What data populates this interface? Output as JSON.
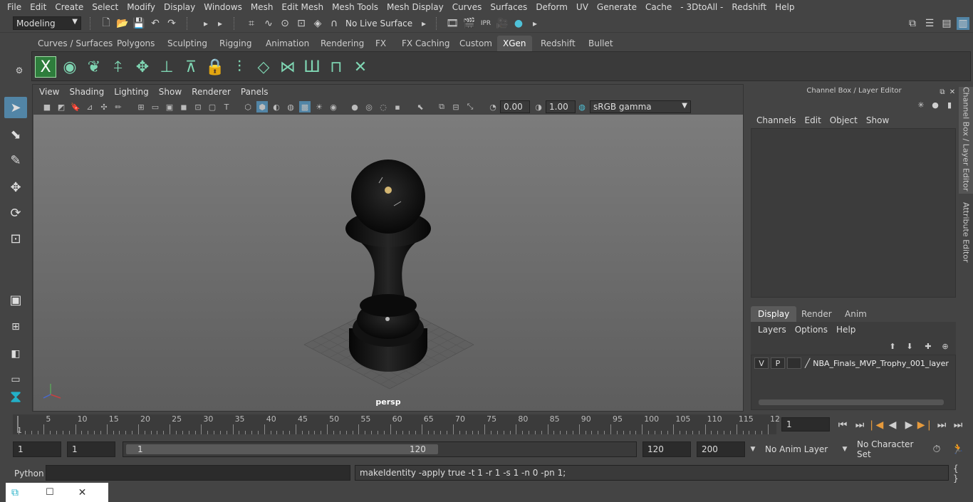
{
  "menu": [
    "File",
    "Edit",
    "Create",
    "Select",
    "Modify",
    "Display",
    "Windows",
    "Mesh",
    "Edit Mesh",
    "Mesh Tools",
    "Mesh Display",
    "Curves",
    "Surfaces",
    "Deform",
    "UV",
    "Generate",
    "Cache",
    "- 3DtoAll -",
    "Redshift",
    "Help"
  ],
  "status": {
    "mode": "Modeling",
    "live_surface": "No Live Surface"
  },
  "shelf_tabs": [
    "Curves / Surfaces",
    "Polygons",
    "Sculpting",
    "Rigging",
    "Animation",
    "Rendering",
    "FX",
    "FX Caching",
    "Custom",
    "XGen",
    "Redshift",
    "Bullet"
  ],
  "active_shelf": "XGen",
  "viewport": {
    "menu": [
      "View",
      "Shading",
      "Lighting",
      "Show",
      "Renderer",
      "Panels"
    ],
    "exposure": "0.00",
    "gamma": "1.00",
    "color_space": "sRGB gamma",
    "camera_label": "persp"
  },
  "channel_box": {
    "title": "Channel Box / Layer Editor",
    "menu": [
      "Channels",
      "Edit",
      "Object",
      "Show"
    ]
  },
  "layer_editor": {
    "tabs": [
      "Display",
      "Render",
      "Anim"
    ],
    "active_tab": "Display",
    "menu": [
      "Layers",
      "Options",
      "Help"
    ],
    "layer": {
      "v": "V",
      "p": "P",
      "name": "NBA_Finals_MVP_Trophy_001_layer"
    }
  },
  "side_tabs": [
    "Channel Box / Layer Editor",
    "Attribute Editor"
  ],
  "timeline": {
    "ticks": [
      "5",
      "10",
      "15",
      "20",
      "25",
      "30",
      "35",
      "40",
      "45",
      "50",
      "55",
      "60",
      "65",
      "70",
      "75",
      "80",
      "85",
      "90",
      "95",
      "100",
      "105",
      "110",
      "115",
      "12"
    ],
    "start_label": "1",
    "current_frame": "1"
  },
  "range": {
    "start": "1",
    "playback_start": "1",
    "slider_start": "1",
    "slider_end": "120",
    "playback_end": "120",
    "end": "200",
    "anim_layer": "No Anim Layer",
    "character_set": "No Character Set"
  },
  "command": {
    "language": "Python",
    "output": "makeIdentity -apply true -t 1 -r 1 -s 1 -n 0 -pn 1;"
  },
  "colors": {
    "accent_active": "#5285a6",
    "bg": "#444444"
  }
}
